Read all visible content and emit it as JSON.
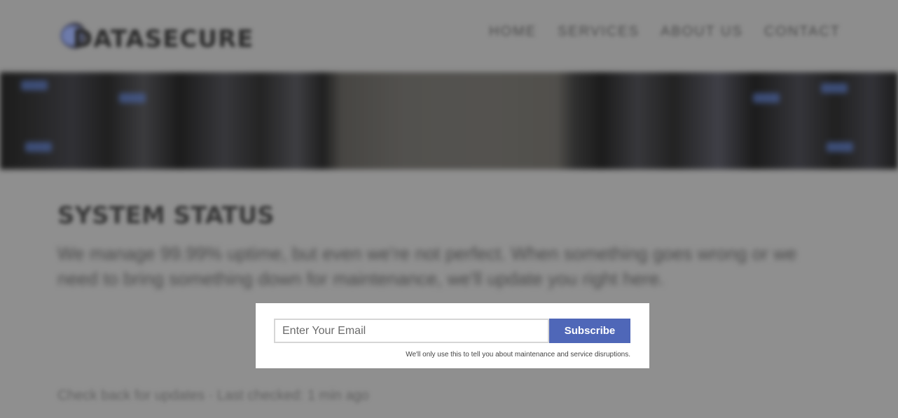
{
  "background": {
    "logo": {
      "text": "DATASECURE",
      "icon": "globe-logo-icon"
    },
    "nav": [
      {
        "label": "HOME"
      },
      {
        "label": "SERVICES"
      },
      {
        "label": "ABOUT US"
      },
      {
        "label": "CONTACT"
      }
    ],
    "section_title": "SYSTEM STATUS",
    "section_text": "We manage 99.99% uptime, but even we're not perfect. When something goes wrong or we need to bring something down for maintenance, we'll update you right here.",
    "footer_text": "Check back for updates · Last checked: 1 min ago",
    "colors": {
      "hero_light": "#3a5aa8"
    }
  },
  "modal": {
    "email_placeholder": "Enter Your Email",
    "email_value": "",
    "subscribe_label": "Subscribe",
    "disclaimer": "We'll only use this to tell you about maintenance and service disruptions."
  },
  "colors": {
    "button": "#4f67b8",
    "overlay": "#9a9a9a",
    "modal": "#ffffff"
  }
}
